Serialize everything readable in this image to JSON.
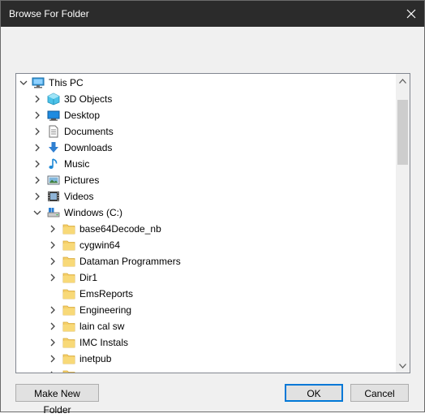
{
  "window": {
    "title": "Browse For Folder"
  },
  "tree": {
    "items": [
      {
        "label": "This PC",
        "icon": "computer-icon",
        "expanded": true
      },
      {
        "label": "3D Objects",
        "icon": "3d-objects-icon"
      },
      {
        "label": "Desktop",
        "icon": "desktop-icon"
      },
      {
        "label": "Documents",
        "icon": "documents-icon"
      },
      {
        "label": "Downloads",
        "icon": "downloads-icon"
      },
      {
        "label": "Music",
        "icon": "music-icon"
      },
      {
        "label": "Pictures",
        "icon": "pictures-icon"
      },
      {
        "label": "Videos",
        "icon": "videos-icon"
      },
      {
        "label": "Windows (C:)",
        "icon": "drive-icon",
        "expanded": true
      },
      {
        "label": "base64Decode_nb",
        "icon": "folder-icon"
      },
      {
        "label": "cygwin64",
        "icon": "folder-icon"
      },
      {
        "label": "Dataman Programmers",
        "icon": "folder-icon"
      },
      {
        "label": "Dir1",
        "icon": "folder-icon"
      },
      {
        "label": "EmsReports",
        "icon": "folder-icon",
        "no_children": true
      },
      {
        "label": "Engineering",
        "icon": "folder-icon"
      },
      {
        "label": "lain cal sw",
        "icon": "folder-icon"
      },
      {
        "label": "IMC Instals",
        "icon": "folder-icon"
      },
      {
        "label": "inetpub",
        "icon": "folder-icon"
      }
    ]
  },
  "buttons": {
    "make_new_folder": "Make New Folder",
    "ok": "OK",
    "cancel": "Cancel"
  },
  "colors": {
    "titlebar": "#2b2b2b",
    "folder": "#f5cf6a",
    "accent": "#0078d7"
  }
}
